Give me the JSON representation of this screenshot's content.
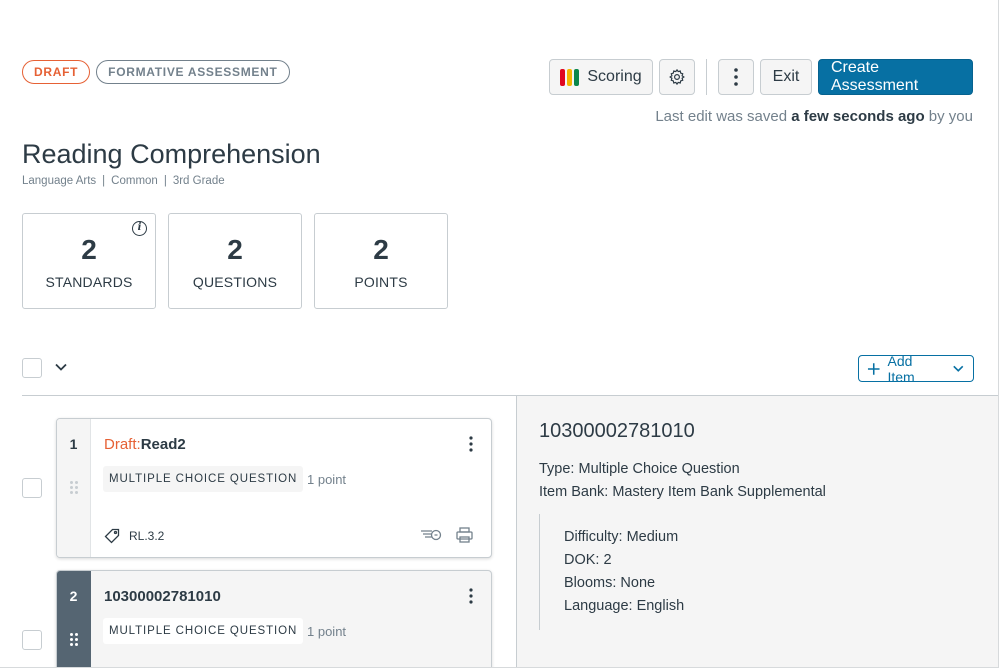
{
  "header": {
    "status_badge": "DRAFT",
    "type_badge": "FORMATIVE ASSESSMENT",
    "scoring_label": "Scoring",
    "exit_label": "Exit",
    "create_label": "Create Assessment",
    "saved_prefix": "Last edit was saved",
    "saved_time": "a few seconds ago",
    "saved_suffix": "by you"
  },
  "assessment": {
    "title": "Reading Comprehension",
    "tags": [
      "Language Arts",
      "Common",
      "3rd Grade"
    ]
  },
  "stats": [
    {
      "value": "2",
      "label": "STANDARDS"
    },
    {
      "value": "2",
      "label": "QUESTIONS"
    },
    {
      "value": "2",
      "label": "POINTS"
    }
  ],
  "list": {
    "add_item_label": "Add Item"
  },
  "items": [
    {
      "number": "1",
      "draft_prefix": "Draft:",
      "title": "Read2",
      "type": "MULTIPLE CHOICE QUESTION",
      "points": "1 point",
      "standard": "RL.3.2"
    },
    {
      "number": "2",
      "title": "10300002781010",
      "type": "MULTIPLE CHOICE QUESTION",
      "points": "1 point"
    }
  ],
  "detail": {
    "id": "10300002781010",
    "type_line": "Type: Multiple Choice Question",
    "bank_line": "Item Bank: Mastery Item Bank Supplemental",
    "difficulty": "Difficulty: Medium",
    "dok": "DOK: 2",
    "blooms": "Blooms: None",
    "language": "Language: English"
  },
  "colors": {
    "brand": "#0770a3",
    "draft": "#e66135",
    "scoring_red": "#e0061f",
    "scoring_yellow": "#fc5e13",
    "scoring_green": "#0b874b"
  }
}
